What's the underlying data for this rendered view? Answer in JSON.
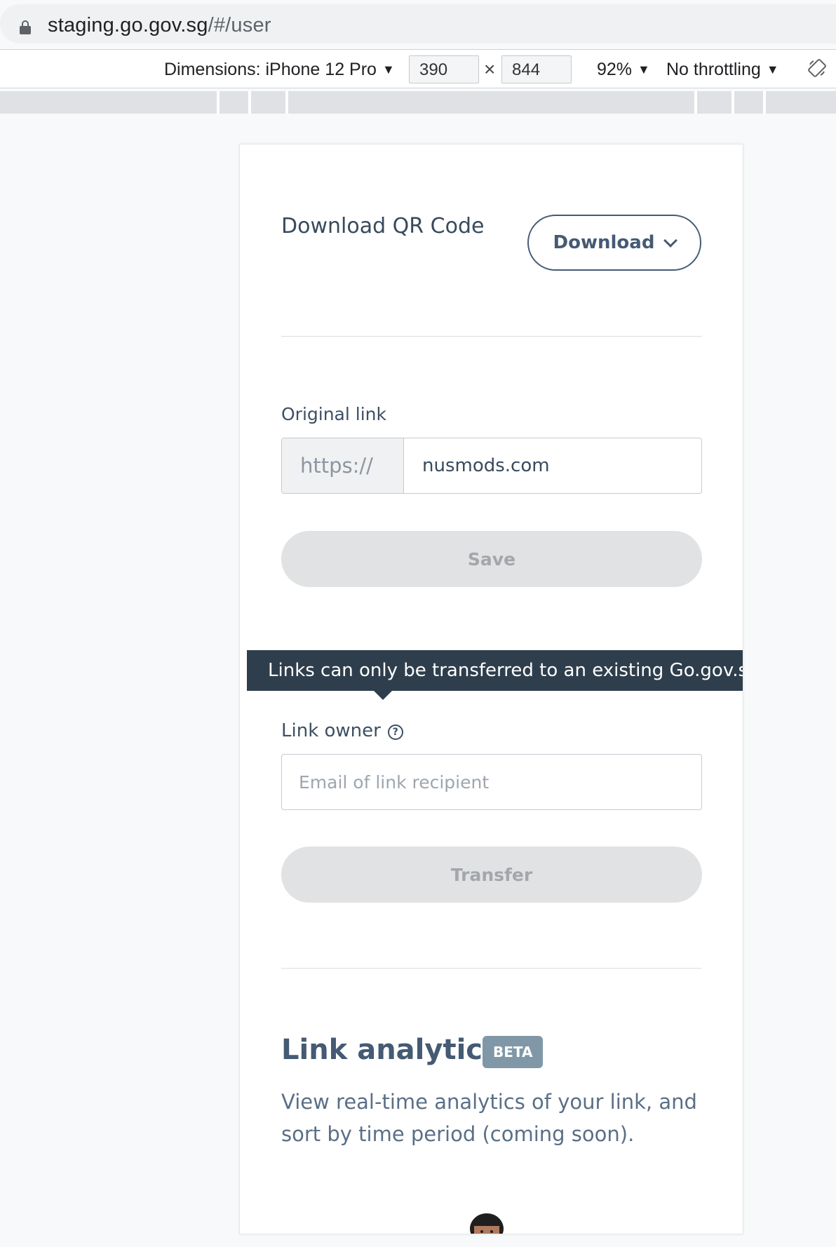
{
  "browser": {
    "url_host": "staging.go.gov.sg",
    "url_path": "/#/user"
  },
  "devtools": {
    "dimensions_label": "Dimensions: iPhone 12 Pro",
    "width": "390",
    "height": "844",
    "times": "×",
    "zoom": "92%",
    "throttling": "No throttling",
    "caret": "▼"
  },
  "qr": {
    "label": "Download QR Code",
    "download_label": "Download"
  },
  "original_link": {
    "label": "Original link",
    "prefix": "https://",
    "value": "nusmods.com",
    "save_label": "Save"
  },
  "tooltip": {
    "text": "Links can only be transferred to an existing Go.gov.sg user"
  },
  "link_owner": {
    "label": "Link owner",
    "help_glyph": "?",
    "placeholder": "Email of link recipient",
    "transfer_label": "Transfer"
  },
  "analytics": {
    "title": "Link analytics",
    "badge": "BETA",
    "description": "View real-time analytics of your link, and sort by time period (coming soon)."
  },
  "icons": [
    "lock-icon",
    "chevron-down-icon",
    "help-circle-icon",
    "rotate-icon"
  ]
}
